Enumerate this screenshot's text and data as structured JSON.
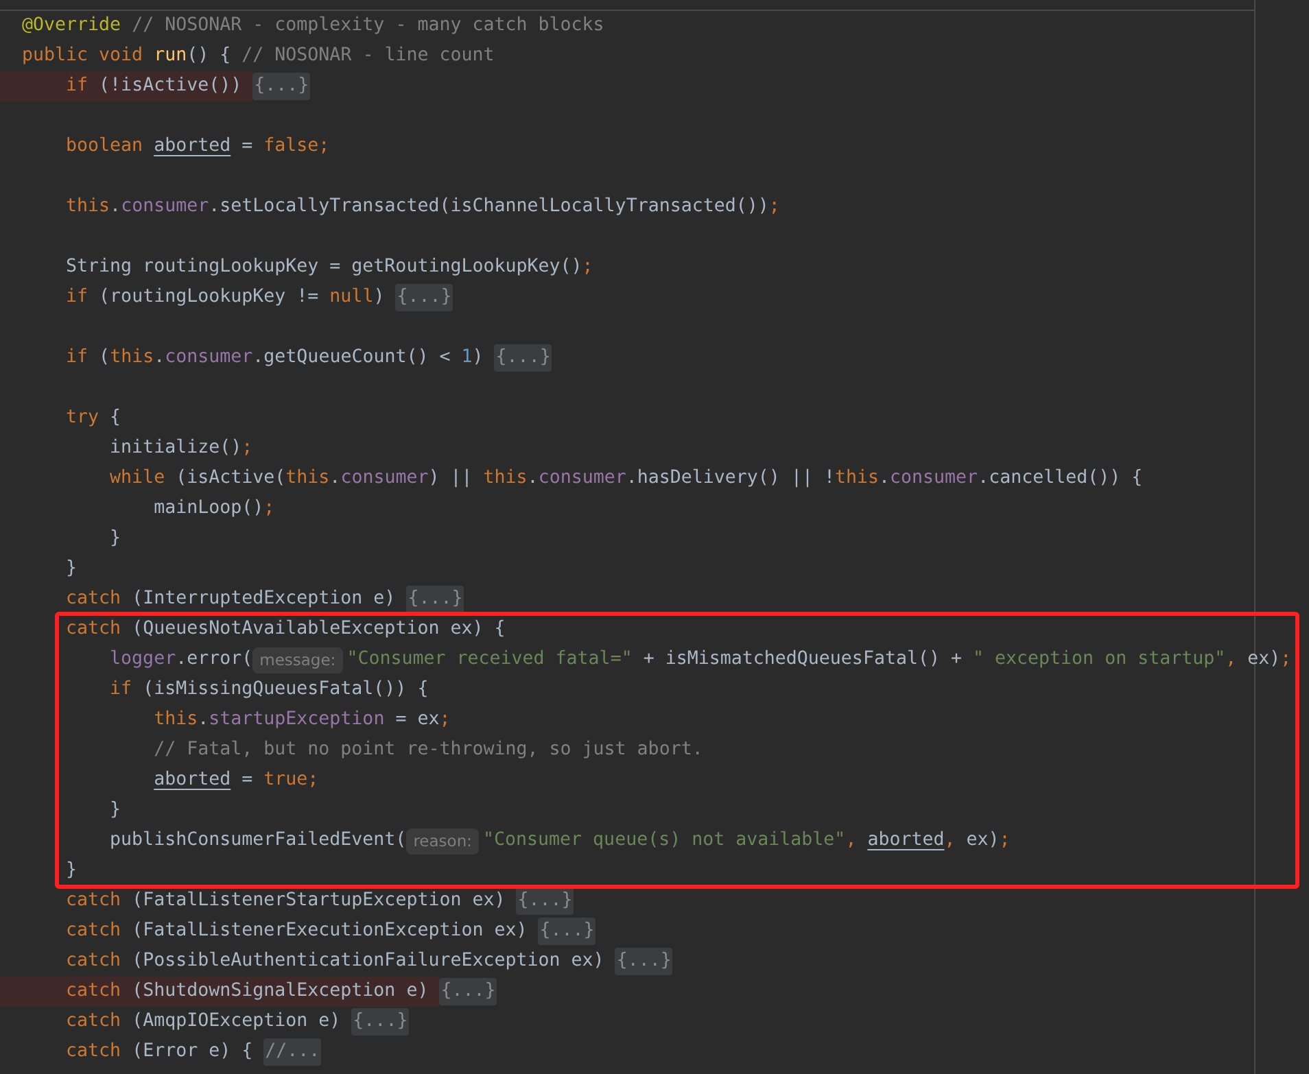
{
  "editor": {
    "lines": [
      {
        "highlighted": false,
        "boxed": false,
        "tokens": [
          {
            "kind": "ann",
            "text": "@Override"
          },
          {
            "kind": "comment",
            "text": " // NOSONAR - complexity - many catch blocks"
          }
        ]
      },
      {
        "highlighted": false,
        "boxed": false,
        "tokens": [
          {
            "kind": "kw",
            "text": "public void "
          },
          {
            "kind": "decl",
            "text": "run"
          },
          {
            "kind": "plain",
            "text": "() { "
          },
          {
            "kind": "comment",
            "text": "// NOSONAR - line count"
          }
        ]
      },
      {
        "highlighted": true,
        "boxed": false,
        "tokens": [
          {
            "kind": "kw",
            "text": "    if "
          },
          {
            "kind": "plain",
            "text": "(!isActive()) "
          },
          {
            "kind": "fold",
            "text": "{...}"
          }
        ]
      },
      {
        "highlighted": false,
        "boxed": false
      },
      {
        "highlighted": false,
        "boxed": false,
        "tokens": [
          {
            "kind": "kw",
            "text": "    boolean "
          },
          {
            "kind": "var",
            "text": "aborted"
          },
          {
            "kind": "plain",
            "text": " = "
          },
          {
            "kind": "kw",
            "text": "false;"
          }
        ]
      },
      {
        "highlighted": false,
        "boxed": false
      },
      {
        "highlighted": false,
        "boxed": false,
        "tokens": [
          {
            "kind": "kw",
            "text": "    this"
          },
          {
            "kind": "plain",
            "text": "."
          },
          {
            "kind": "field",
            "text": "consumer"
          },
          {
            "kind": "plain",
            "text": ".setLocallyTransacted(isChannelLocallyTransacted())"
          },
          {
            "kind": "kw",
            "text": ";"
          }
        ]
      },
      {
        "highlighted": false,
        "boxed": false
      },
      {
        "highlighted": false,
        "boxed": false,
        "tokens": [
          {
            "kind": "plain",
            "text": "    String routingLookupKey = getRoutingLookupKey()"
          },
          {
            "kind": "kw",
            "text": ";"
          }
        ]
      },
      {
        "highlighted": false,
        "boxed": false,
        "tokens": [
          {
            "kind": "kw",
            "text": "    if "
          },
          {
            "kind": "plain",
            "text": "(routingLookupKey != "
          },
          {
            "kind": "kw",
            "text": "null"
          },
          {
            "kind": "plain",
            "text": ") "
          },
          {
            "kind": "fold",
            "text": "{...}"
          }
        ]
      },
      {
        "highlighted": false,
        "boxed": false
      },
      {
        "highlighted": false,
        "boxed": false,
        "tokens": [
          {
            "kind": "kw",
            "text": "    if "
          },
          {
            "kind": "plain",
            "text": "("
          },
          {
            "kind": "kw",
            "text": "this"
          },
          {
            "kind": "plain",
            "text": "."
          },
          {
            "kind": "field",
            "text": "consumer"
          },
          {
            "kind": "plain",
            "text": ".getQueueCount() < "
          },
          {
            "kind": "num",
            "text": "1"
          },
          {
            "kind": "plain",
            "text": ") "
          },
          {
            "kind": "fold",
            "text": "{...}"
          }
        ]
      },
      {
        "highlighted": false,
        "boxed": false
      },
      {
        "highlighted": false,
        "boxed": false,
        "tokens": [
          {
            "kind": "kw",
            "text": "    try "
          },
          {
            "kind": "plain",
            "text": "{"
          }
        ]
      },
      {
        "highlighted": false,
        "boxed": false,
        "tokens": [
          {
            "kind": "plain",
            "text": "        initialize()"
          },
          {
            "kind": "kw",
            "text": ";"
          }
        ]
      },
      {
        "highlighted": false,
        "boxed": false,
        "tokens": [
          {
            "kind": "kw",
            "text": "        while "
          },
          {
            "kind": "plain",
            "text": "(isActive("
          },
          {
            "kind": "kw",
            "text": "this"
          },
          {
            "kind": "plain",
            "text": "."
          },
          {
            "kind": "field",
            "text": "consumer"
          },
          {
            "kind": "plain",
            "text": ") || "
          },
          {
            "kind": "kw",
            "text": "this"
          },
          {
            "kind": "plain",
            "text": "."
          },
          {
            "kind": "field",
            "text": "consumer"
          },
          {
            "kind": "plain",
            "text": ".hasDelivery() || !"
          },
          {
            "kind": "kw",
            "text": "this"
          },
          {
            "kind": "plain",
            "text": "."
          },
          {
            "kind": "field",
            "text": "consumer"
          },
          {
            "kind": "plain",
            "text": ".cancelled()) {"
          }
        ]
      },
      {
        "highlighted": false,
        "boxed": false,
        "tokens": [
          {
            "kind": "plain",
            "text": "            mainLoop()"
          },
          {
            "kind": "kw",
            "text": ";"
          }
        ]
      },
      {
        "highlighted": false,
        "boxed": false,
        "tokens": [
          {
            "kind": "plain",
            "text": "        }"
          }
        ]
      },
      {
        "highlighted": false,
        "boxed": false,
        "tokens": [
          {
            "kind": "plain",
            "text": "    }"
          }
        ]
      },
      {
        "highlighted": false,
        "boxed": false,
        "tokens": [
          {
            "kind": "kw",
            "text": "    catch "
          },
          {
            "kind": "plain",
            "text": "(InterruptedException e) "
          },
          {
            "kind": "fold",
            "text": "{...}"
          }
        ]
      },
      {
        "highlighted": false,
        "boxed": true,
        "tokens": [
          {
            "kind": "kw",
            "text": "    catch "
          },
          {
            "kind": "plain",
            "text": "(QueuesNotAvailableException ex) {"
          }
        ]
      },
      {
        "highlighted": false,
        "boxed": true,
        "tokens": [
          {
            "kind": "field",
            "text": "        logger"
          },
          {
            "kind": "plain",
            "text": ".error("
          },
          {
            "kind": "hint",
            "text": "message:"
          },
          {
            "kind": "str",
            "text": "\"Consumer received fatal=\""
          },
          {
            "kind": "plain",
            "text": " + isMismatchedQueuesFatal() + "
          },
          {
            "kind": "str",
            "text": "\" exception on startup\""
          },
          {
            "kind": "kw",
            "text": ","
          },
          {
            "kind": "plain",
            "text": " ex)"
          },
          {
            "kind": "kw",
            "text": ";"
          }
        ]
      },
      {
        "highlighted": false,
        "boxed": true,
        "tokens": [
          {
            "kind": "kw",
            "text": "        if "
          },
          {
            "kind": "plain",
            "text": "(isMissingQueuesFatal()) {"
          }
        ]
      },
      {
        "highlighted": false,
        "boxed": true,
        "tokens": [
          {
            "kind": "kw",
            "text": "            this"
          },
          {
            "kind": "plain",
            "text": "."
          },
          {
            "kind": "field",
            "text": "startupException"
          },
          {
            "kind": "plain",
            "text": " = ex"
          },
          {
            "kind": "kw",
            "text": ";"
          }
        ]
      },
      {
        "highlighted": false,
        "boxed": true,
        "tokens": [
          {
            "kind": "comment",
            "text": "            // Fatal, but no point re-throwing, so just abort."
          }
        ]
      },
      {
        "highlighted": false,
        "boxed": true,
        "tokens": [
          {
            "kind": "var",
            "text": "            aborted"
          },
          {
            "kind": "plain",
            "text": " = "
          },
          {
            "kind": "kw",
            "text": "true;"
          }
        ]
      },
      {
        "highlighted": false,
        "boxed": true,
        "tokens": [
          {
            "kind": "plain",
            "text": "        }"
          }
        ]
      },
      {
        "highlighted": false,
        "boxed": true,
        "tokens": [
          {
            "kind": "plain",
            "text": "        publishConsumerFailedEvent("
          },
          {
            "kind": "hint",
            "text": "reason:"
          },
          {
            "kind": "str",
            "text": "\"Consumer queue(s) not available\""
          },
          {
            "kind": "kw",
            "text": ", "
          },
          {
            "kind": "var",
            "text": "aborted"
          },
          {
            "kind": "kw",
            "text": ","
          },
          {
            "kind": "plain",
            "text": " ex)"
          },
          {
            "kind": "kw",
            "text": ";"
          }
        ]
      },
      {
        "highlighted": false,
        "boxed": true,
        "tokens": [
          {
            "kind": "plain",
            "text": "    }"
          }
        ]
      },
      {
        "highlighted": false,
        "boxed": false,
        "tokens": [
          {
            "kind": "kw",
            "text": "    catch "
          },
          {
            "kind": "plain",
            "text": "(FatalListenerStartupException ex) "
          },
          {
            "kind": "fold",
            "text": "{...}"
          }
        ]
      },
      {
        "highlighted": false,
        "boxed": false,
        "tokens": [
          {
            "kind": "kw",
            "text": "    catch "
          },
          {
            "kind": "plain",
            "text": "(FatalListenerExecutionException ex) "
          },
          {
            "kind": "fold",
            "text": "{...}"
          }
        ]
      },
      {
        "highlighted": false,
        "boxed": false,
        "tokens": [
          {
            "kind": "kw",
            "text": "    catch "
          },
          {
            "kind": "plain",
            "text": "(PossibleAuthenticationFailureException ex) "
          },
          {
            "kind": "fold",
            "text": "{...}"
          }
        ]
      },
      {
        "highlighted": true,
        "boxed": false,
        "tokens": [
          {
            "kind": "kw",
            "text": "    catch "
          },
          {
            "kind": "plain",
            "text": "(ShutdownSignalException e) "
          },
          {
            "kind": "fold",
            "text": "{...}"
          }
        ]
      },
      {
        "highlighted": false,
        "boxed": false,
        "tokens": [
          {
            "kind": "kw",
            "text": "    catch "
          },
          {
            "kind": "plain",
            "text": "(AmqpIOException e) "
          },
          {
            "kind": "fold",
            "text": "{...}"
          }
        ]
      },
      {
        "highlighted": false,
        "boxed": false,
        "tokens": [
          {
            "kind": "kw",
            "text": "    catch "
          },
          {
            "kind": "plain",
            "text": "(Error e) { "
          },
          {
            "kind": "fold",
            "text": "//..."
          }
        ]
      }
    ]
  }
}
